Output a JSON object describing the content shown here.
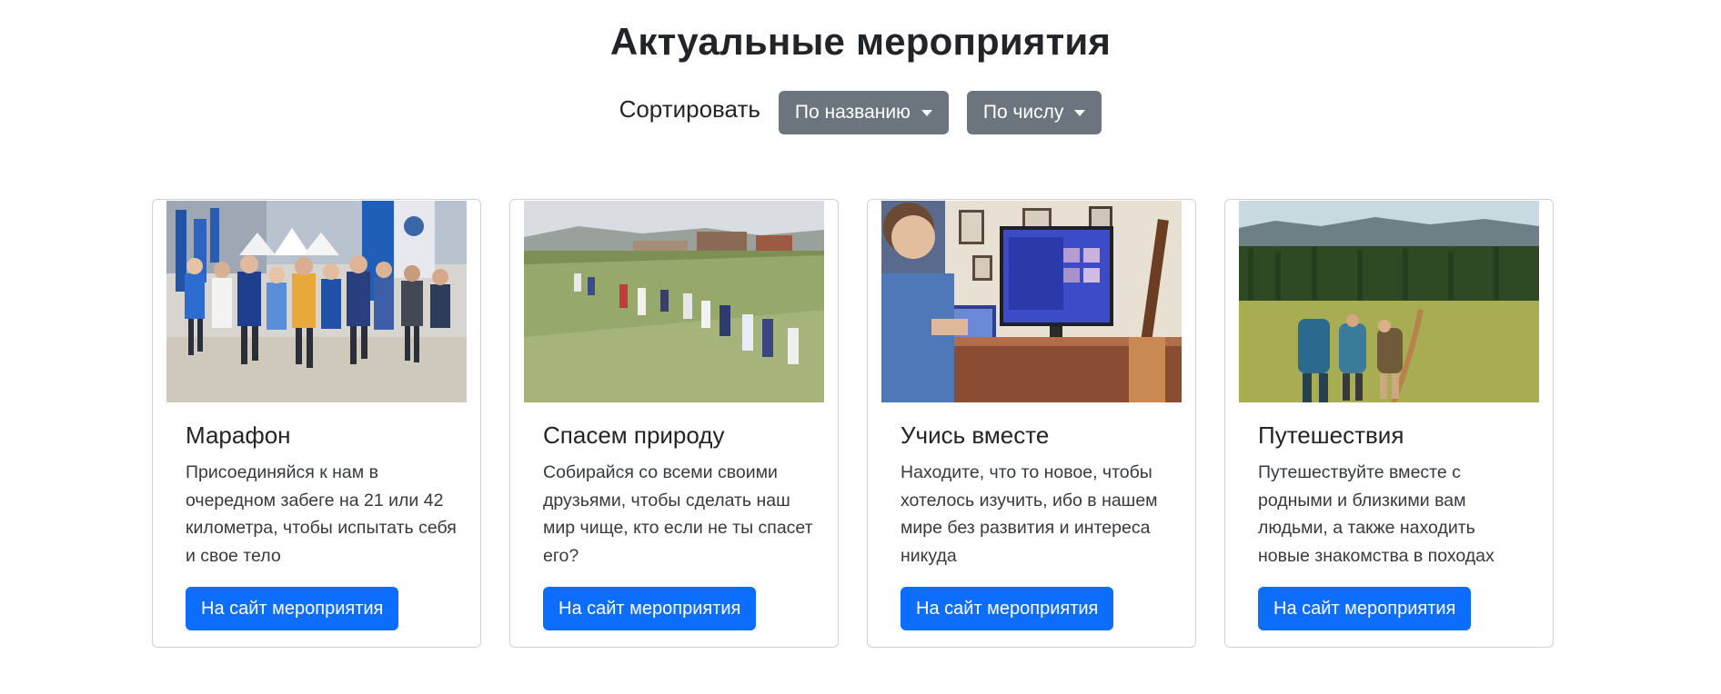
{
  "header": {
    "title": "Актуальные мероприятия"
  },
  "sort": {
    "label": "Сортировать",
    "by_name": "По названию",
    "by_number": "По числу"
  },
  "cards": [
    {
      "title": "Марафон",
      "text": "Присоединяйся к нам в очередном забеге на 21 или 42 километра, чтобы испытать себя и свое тело",
      "button": "На сайт мероприятия",
      "image": "marathon-runners-photo"
    },
    {
      "title": "Спасем природу",
      "text": "Собирайся со всеми своими друзьями, чтобы сделать наш мир чище, кто если не ты спасет его?",
      "button": "На сайт мероприятия",
      "image": "volunteers-cleanup-photo"
    },
    {
      "title": "Учись вместе",
      "text": "Находите, что то новое, чтобы хотелось изучить, ибо в нашем мире без развития и интереса никуда",
      "button": "На сайт мероприятия",
      "image": "student-at-computer-photo"
    },
    {
      "title": "Путешествия",
      "text": "Путешествуйте вместе с родными и близкими вам людьми, а также находить новые знакомства в походах",
      "button": "На сайт мероприятия",
      "image": "hikers-in-field-photo"
    }
  ],
  "colors": {
    "primary": "#0d6efd",
    "secondary": "#6c757d",
    "text": "#212529"
  }
}
